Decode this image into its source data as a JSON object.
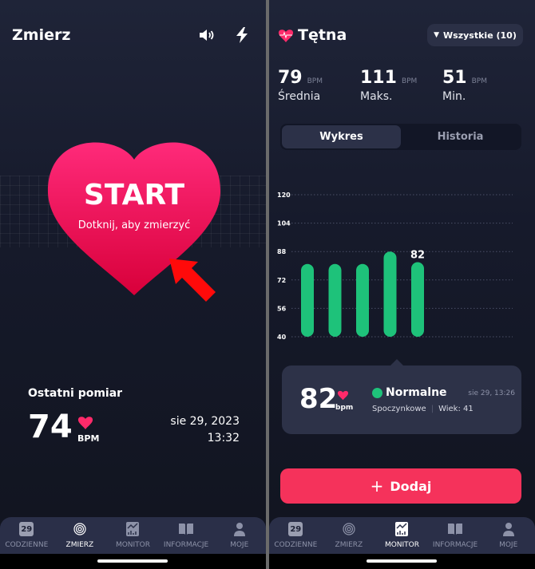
{
  "left": {
    "title": "Zmierz",
    "icons": [
      "speaker-icon",
      "flash-icon"
    ],
    "start": {
      "label": "START",
      "hint": "Dotknij, aby zmierzyć",
      "color": "#ff2a7a"
    },
    "last": {
      "heading": "Ostatni pomiar",
      "value": "74",
      "unit": "BPM",
      "date": "sie 29, 2023",
      "time": "13:32"
    },
    "active_tab": "ZMIERZ"
  },
  "right": {
    "title": "Tętna",
    "filter": "Wszystkie (10)",
    "stats": [
      {
        "value": "79",
        "unit": "BPM",
        "label": "Średnia"
      },
      {
        "value": "111",
        "unit": "BPM",
        "label": "Maks."
      },
      {
        "value": "51",
        "unit": "BPM",
        "label": "Min."
      }
    ],
    "segments": [
      "Wykres",
      "Historia"
    ],
    "active_segment": "Wykres",
    "card": {
      "value": "82",
      "unit": "bpm",
      "status": "Normalne",
      "status_color": "#1ec27a",
      "type": "Spoczynkowe",
      "age": "Wiek: 41",
      "date": "sie 29, 13:26"
    },
    "add_label": "Dodaj",
    "active_tab": "MONITOR"
  },
  "tabs": [
    {
      "label": "CODZIENNE",
      "badge": "29",
      "icon": "calendar-icon"
    },
    {
      "label": "ZMIERZ",
      "icon": "fingerprint-icon"
    },
    {
      "label": "MONITOR",
      "icon": "chart-icon"
    },
    {
      "label": "INFORMACJE",
      "icon": "book-icon"
    },
    {
      "label": "MOJE",
      "icon": "user-icon"
    }
  ],
  "chart_data": {
    "type": "bar",
    "yticks": [
      120,
      104,
      88,
      72,
      56,
      40
    ],
    "ylim": [
      40,
      120
    ],
    "values": [
      81,
      81,
      81,
      88,
      82
    ],
    "selected_label": "82",
    "bar_color": "#1ec27a",
    "grid": true
  }
}
